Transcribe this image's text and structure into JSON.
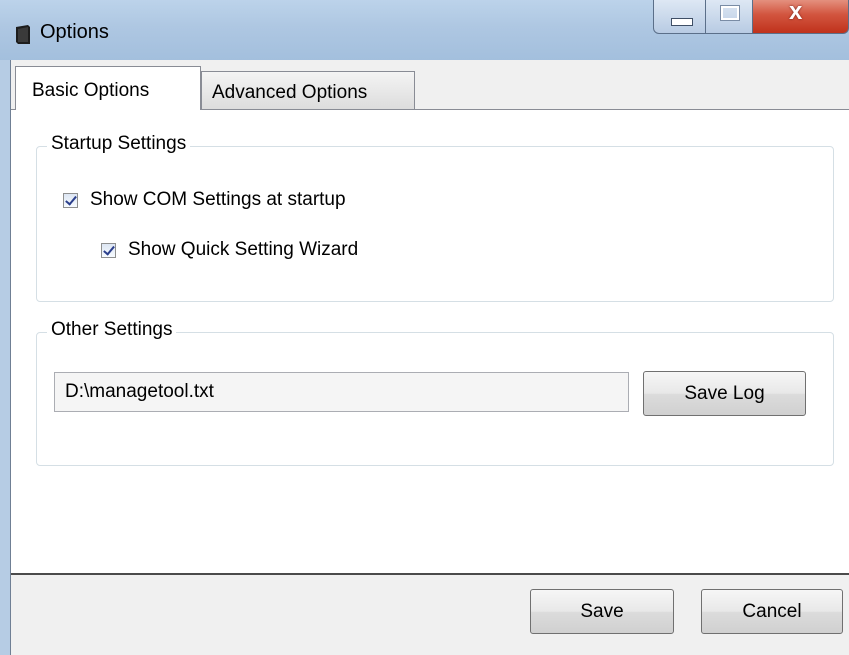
{
  "window": {
    "title": "Options"
  },
  "tabs": [
    {
      "label": "Basic Options",
      "active": true
    },
    {
      "label": "Advanced Options",
      "active": false
    }
  ],
  "startup_settings": {
    "legend": "Startup Settings",
    "show_com_settings": {
      "label": "Show COM Settings at startup",
      "checked": true
    },
    "show_quick_wizard": {
      "label": "Show Quick Setting Wizard",
      "checked": true
    }
  },
  "other_settings": {
    "legend": "Other Settings",
    "log_path": {
      "value": "D:\\managetool.txt"
    },
    "save_log_label": "Save Log"
  },
  "footer": {
    "save_label": "Save",
    "cancel_label": "Cancel"
  },
  "colors": {
    "titlebar": "#aec7e2",
    "close_button": "#c0321c",
    "panel_bg": "#ffffff",
    "dialog_bg": "#f0f0f0"
  }
}
